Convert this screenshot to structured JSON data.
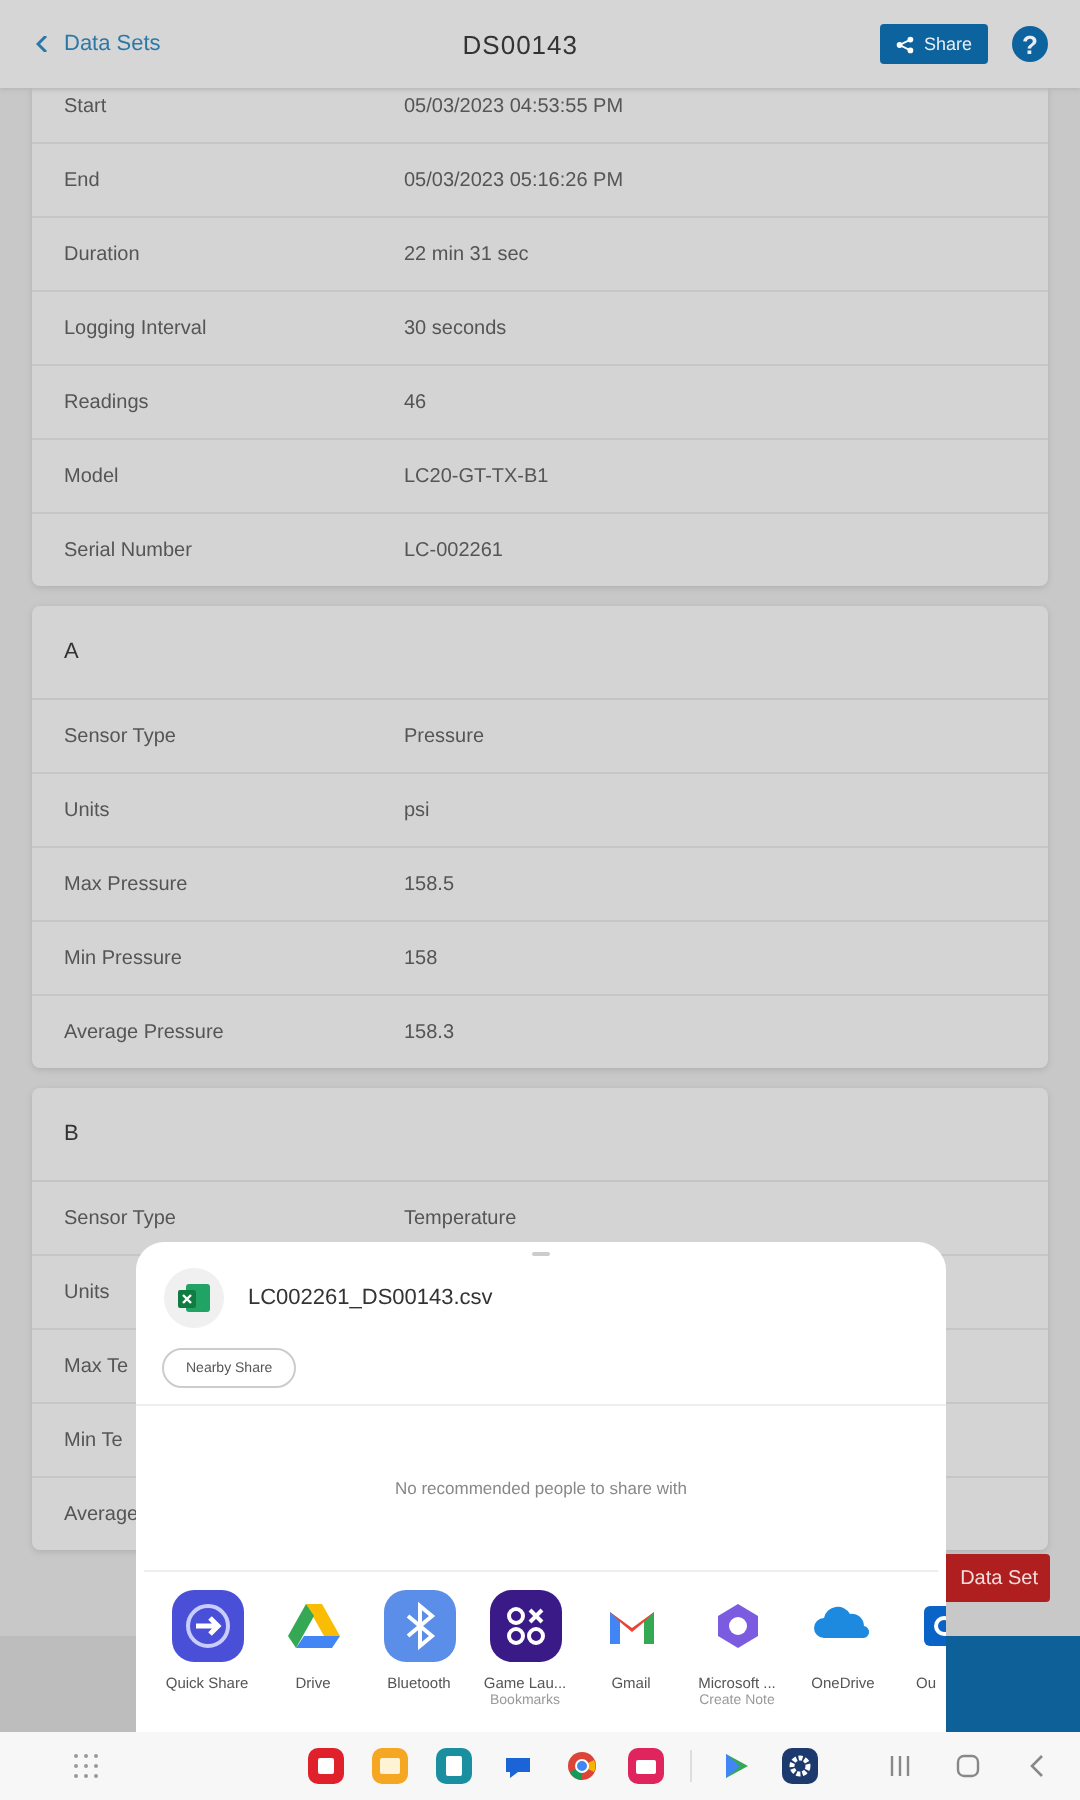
{
  "header": {
    "back_label": "Data Sets",
    "title": "DS00143",
    "share_label": "Share",
    "help_label": "?"
  },
  "cards": [
    {
      "rows": [
        {
          "label": "Start",
          "value": "05/03/2023 04:53:55 PM"
        },
        {
          "label": "End",
          "value": "05/03/2023 05:16:26 PM"
        },
        {
          "label": "Duration",
          "value": "22 min 31 sec"
        },
        {
          "label": "Logging Interval",
          "value": "30 seconds"
        },
        {
          "label": "Readings",
          "value": "46"
        },
        {
          "label": "Model",
          "value": "LC20-GT-TX-B1"
        },
        {
          "label": "Serial Number",
          "value": "LC-002261"
        }
      ]
    },
    {
      "title": "A",
      "rows": [
        {
          "label": "Sensor Type",
          "value": "Pressure"
        },
        {
          "label": "Units",
          "value": "psi"
        },
        {
          "label": "Max Pressure",
          "value": "158.5"
        },
        {
          "label": "Min Pressure",
          "value": "158"
        },
        {
          "label": "Average Pressure",
          "value": "158.3"
        }
      ]
    },
    {
      "title": "B",
      "rows": [
        {
          "label": "Sensor Type",
          "value": "Temperature"
        },
        {
          "label": "Units"
        },
        {
          "label": "Max Te"
        },
        {
          "label": "Min Te"
        },
        {
          "label": "Average"
        }
      ]
    }
  ],
  "delete_button": "Data Set",
  "share_sheet": {
    "file_name": "LC002261_DS00143.csv",
    "nearby_share": "Nearby Share",
    "empty_message": "No recommended people to share with",
    "apps": [
      {
        "label": "Quick Share"
      },
      {
        "label": "Drive"
      },
      {
        "label": "Bluetooth"
      },
      {
        "label": "Game Lau...",
        "sublabel": "Bookmarks"
      },
      {
        "label": "Gmail"
      },
      {
        "label": "Microsoft ...",
        "sublabel": "Create Note"
      },
      {
        "label": "OneDrive"
      },
      {
        "label": "Ou"
      }
    ]
  }
}
